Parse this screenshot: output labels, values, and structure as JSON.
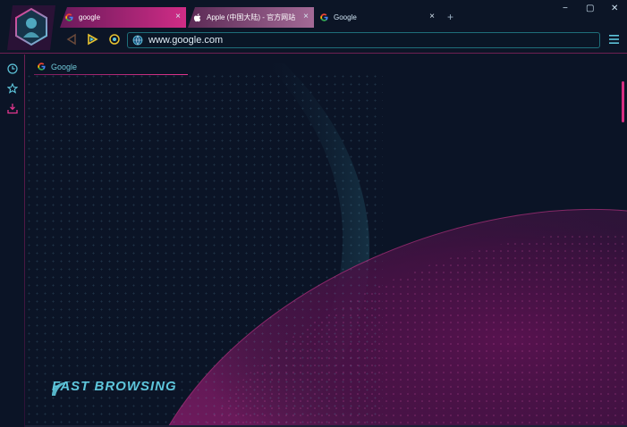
{
  "tabs": [
    {
      "label": "google",
      "icon": "google-icon",
      "active": true
    },
    {
      "label": "Apple (中国大陆) - 官方网站",
      "icon": "apple-icon"
    },
    {
      "label": "Google",
      "icon": "google-icon"
    }
  ],
  "toolbar": {
    "new_tab": "+",
    "url": "www.google.com"
  },
  "window_controls": {
    "minimize": "−",
    "maximize": "▢",
    "close": "✕"
  },
  "sidebar": [
    "history-icon",
    "favorites-icon",
    "downloads-icon"
  ],
  "content": {
    "tab_label": "Google",
    "brand": "FAST BROWSING"
  },
  "colors": {
    "accent_pink": "#d52e80",
    "accent_cyan": "#5ec6dc",
    "background": "#0b1426"
  }
}
